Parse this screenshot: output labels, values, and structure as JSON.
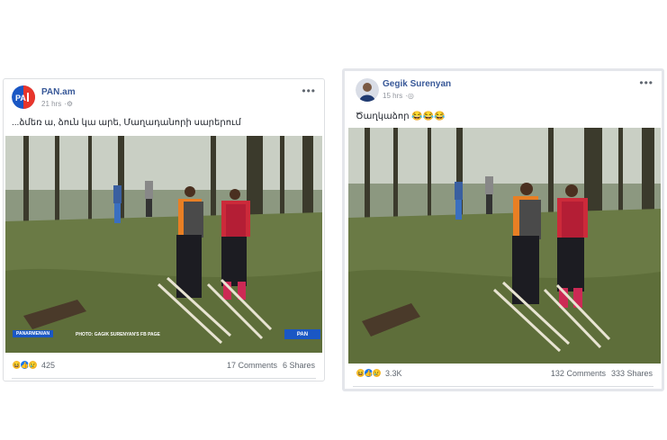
{
  "posts": [
    {
      "author": "PAN.am",
      "time": "21 hrs",
      "text": "...ձմեռ ա, ձուն կա արե, Մաղադանորի սարերում",
      "watermark_left": "PANARMENIAN",
      "watermark_mid": "PHOTO: GAGIK SURENYAN'S FB PAGE",
      "watermark_right": "PAN",
      "reaction_icons": [
        "haha-icon",
        "like-icon",
        "sad-icon"
      ],
      "reaction_count": "425",
      "comments": "17 Comments",
      "shares": "6 Shares"
    },
    {
      "author": "Gegik Surenyan",
      "time": "15 hrs",
      "text": "Ծաղկաձոր 😂😂😂",
      "reaction_icons": [
        "haha-icon",
        "like-icon",
        "sad-icon"
      ],
      "reaction_count": "3.3K",
      "comments": "132 Comments",
      "shares": "333 Shares"
    }
  ],
  "colors": {
    "author": "#385898",
    "muted": "#90949c",
    "like": "#1877f2",
    "haha": "#f7b928"
  }
}
